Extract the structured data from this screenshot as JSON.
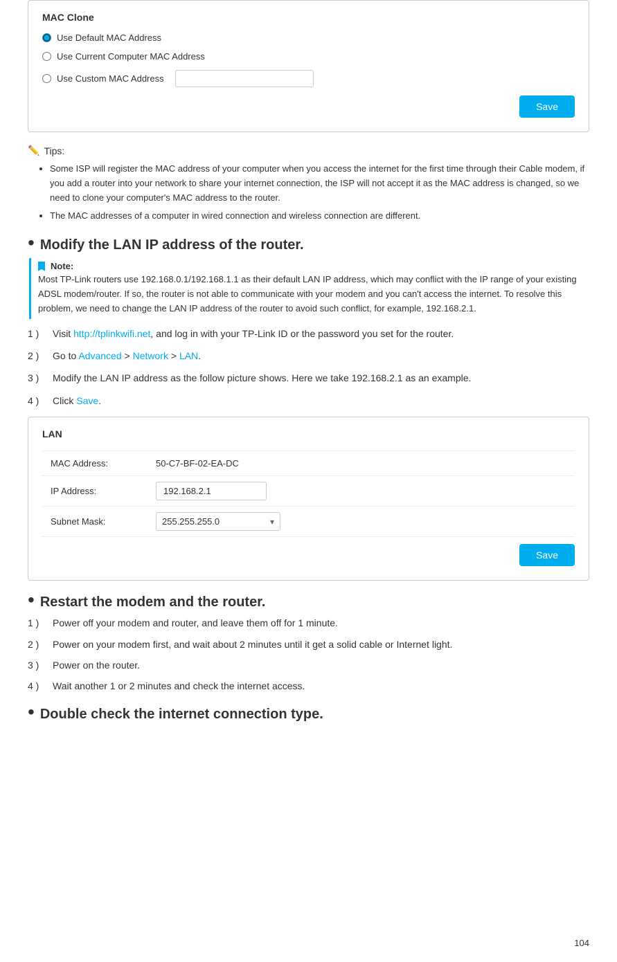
{
  "mac_clone_panel": {
    "title": "MAC Clone",
    "option1_label": "Use Default MAC Address",
    "option2_label": "Use Current Computer MAC Address",
    "option3_label": "Use Custom MAC Address",
    "save_button": "Save"
  },
  "tips": {
    "header": "Tips:",
    "tip1": "Some ISP will register the MAC address of your computer when you access the internet for the first time through their Cable modem, if you add a router into your network to share your internet connection, the ISP will not accept it as the MAC address is changed, so we need to clone your computer's MAC address to the router.",
    "tip2": "The MAC addresses of a computer in wired connection and wireless connection are different."
  },
  "section_modify_lan": {
    "bullet": "•",
    "title": "Modify the LAN IP address of the router.",
    "note_label": "Note:",
    "note_text": "Most TP-Link routers use 192.168.0.1/192.168.1.1 as their default LAN IP address, which may conflict with the IP range of your existing ADSL modem/router. If so, the router is not able to communicate with your modem and you can't access the internet. To resolve this problem, we need to change the LAN IP address of the router to avoid such conflict, for example, 192.168.2.1.",
    "steps": [
      {
        "num": "1 )",
        "text_before": "Visit ",
        "link": "http://tplinkwifi.net",
        "text_after": ", and log in with your TP-Link ID or the password you set for the router."
      },
      {
        "num": "2 )",
        "text_before": "Go to ",
        "advanced": "Advanced",
        "sep1": " > ",
        "network": "Network",
        "sep2": " > ",
        "lan": "LAN",
        "text_after": "."
      },
      {
        "num": "3 )",
        "text": "Modify the LAN IP address as the follow picture shows. Here we take 192.168.2.1 as an example."
      },
      {
        "num": "4 )",
        "text_before": "Click ",
        "save": "Save",
        "text_after": "."
      }
    ]
  },
  "lan_panel": {
    "title": "LAN",
    "mac_label": "MAC Address:",
    "mac_value": "50-C7-BF-02-EA-DC",
    "ip_label": "IP Address:",
    "ip_value": "192.168.2.1",
    "subnet_label": "Subnet Mask:",
    "subnet_value": "255.255.255.0",
    "save_button": "Save"
  },
  "section_restart": {
    "bullet": "•",
    "title": "Restart the modem and the router.",
    "steps": [
      {
        "num": "1 )",
        "text": "Power off your modem and router, and leave them off for 1 minute."
      },
      {
        "num": "2 )",
        "text": "Power on your modem first, and wait about 2 minutes until it get a solid cable or Internet light."
      },
      {
        "num": "3 )",
        "text": "Power on the router."
      },
      {
        "num": "4 )",
        "text": "Wait another 1 or 2 minutes and check the internet access."
      }
    ]
  },
  "section_double_check": {
    "bullet": "•",
    "title": "Double check the internet connection type."
  },
  "page_number": "104"
}
